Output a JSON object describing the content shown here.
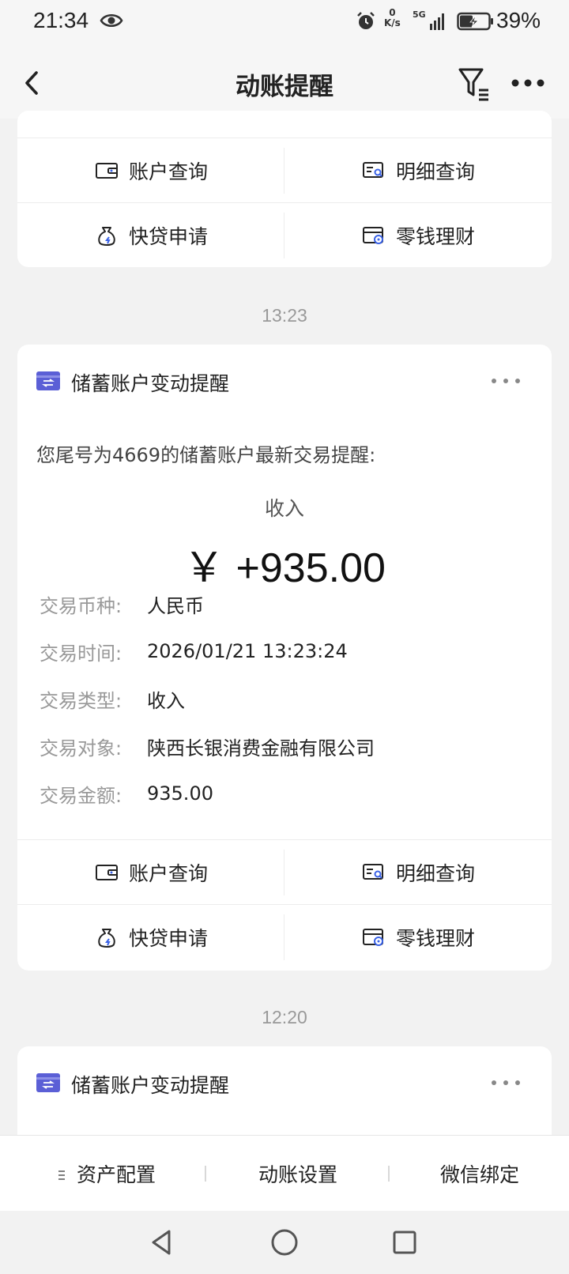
{
  "status_bar": {
    "time": "21:34",
    "net_speed_value": "0",
    "net_speed_unit": "K/s",
    "network": "5G",
    "battery": "39%",
    "icons": [
      "eye-icon",
      "alarm-icon",
      "signal-icon",
      "battery-charging-icon"
    ]
  },
  "header": {
    "title": "动账提醒",
    "icons": [
      "back-arrow-icon",
      "filter-icon",
      "more-icon"
    ]
  },
  "actions": {
    "account_query": "账户查询",
    "detail_query": "明细查询",
    "quick_loan": "快贷申请",
    "wealth": "零钱理财"
  },
  "messages": [
    {
      "time": "13:23",
      "title": "储蓄账户变动提醒",
      "intro": "您尾号为4669的储蓄账户最新交易提醒:",
      "amount_label": "收入",
      "amount": "￥ +935.00",
      "details": [
        {
          "key": "交易币种:",
          "value": "人民币"
        },
        {
          "key": "交易时间:",
          "value": "2026/01/21 13:23:24"
        },
        {
          "key": "交易类型:",
          "value": "收入"
        },
        {
          "key": "交易对象:",
          "value": "陕西长银消费金融有限公司"
        },
        {
          "key": "交易金额:",
          "value": "935.00"
        }
      ]
    },
    {
      "time": "12:20",
      "title": "储蓄账户变动提醒"
    }
  ],
  "bottom_bar": {
    "asset_config": "资产配置",
    "account_settings": "动账设置",
    "wechat_bind": "微信绑定"
  },
  "colors": {
    "card_icon": "#5b5fd6",
    "action_icon_accent": "#3a62e6",
    "page_bg": "#f2f2f2"
  }
}
